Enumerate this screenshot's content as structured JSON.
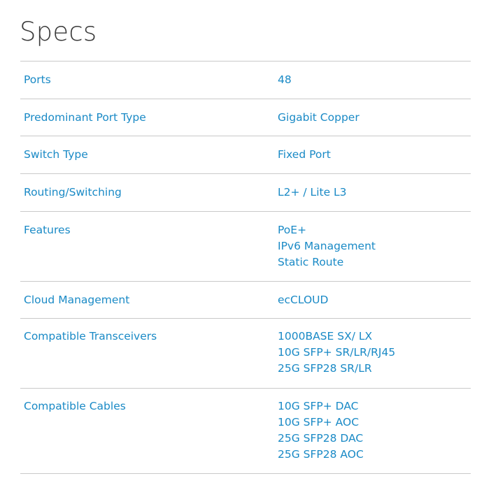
{
  "page": {
    "title": "Specs"
  },
  "specs": [
    {
      "label": "Ports",
      "values": [
        "48"
      ]
    },
    {
      "label": "Predominant Port Type",
      "values": [
        "Gigabit Copper"
      ]
    },
    {
      "label": "Switch Type",
      "values": [
        "Fixed Port"
      ]
    },
    {
      "label": "Routing/Switching",
      "values": [
        "L2+ / Lite L3"
      ]
    },
    {
      "label": "Features",
      "values": [
        "PoE+",
        "IPv6 Management",
        "Static Route"
      ]
    },
    {
      "label": "Cloud Management",
      "values": [
        "ecCLOUD"
      ]
    },
    {
      "label": "Compatible Transceivers",
      "values": [
        "1000BASE SX/ LX",
        "10G SFP+ SR/LR/RJ45",
        "25G SFP28 SR/LR"
      ]
    },
    {
      "label": "Compatible Cables",
      "values": [
        "10G SFP+ DAC",
        "10G SFP+ AOC",
        "25G SFP28 DAC",
        "25G SFP28 AOC"
      ]
    }
  ]
}
